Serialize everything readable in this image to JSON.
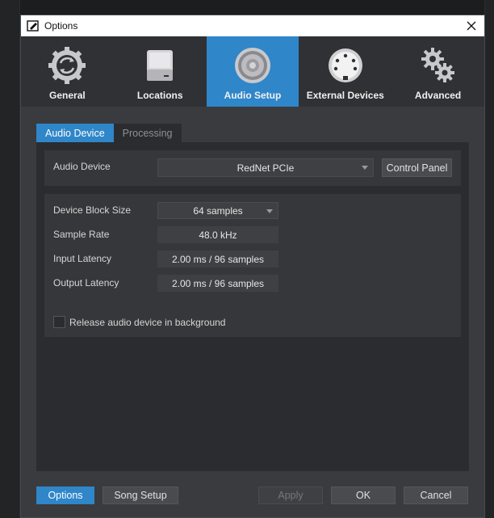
{
  "window": {
    "title": "Options"
  },
  "categories": [
    {
      "label": "General",
      "icon": "refresh-gear-icon",
      "active": false
    },
    {
      "label": "Locations",
      "icon": "hard-drive-icon",
      "active": false
    },
    {
      "label": "Audio Setup",
      "icon": "speaker-icon",
      "active": true
    },
    {
      "label": "External Devices",
      "icon": "midi-connector-icon",
      "active": false
    },
    {
      "label": "Advanced",
      "icon": "gears-icon",
      "active": false
    }
  ],
  "tabs": [
    {
      "label": "Audio Device",
      "active": true
    },
    {
      "label": "Processing",
      "active": false
    }
  ],
  "audio_device": {
    "label": "Audio Device",
    "value": "RedNet PCIe",
    "control_panel_label": "Control Panel"
  },
  "settings": {
    "block_size": {
      "label": "Device Block Size",
      "value": "64 samples"
    },
    "sample_rate": {
      "label": "Sample Rate",
      "value": "48.0 kHz"
    },
    "input_latency": {
      "label": "Input Latency",
      "value": "2.00 ms / 96 samples"
    },
    "output_latency": {
      "label": "Output Latency",
      "value": "2.00 ms / 96 samples"
    }
  },
  "release_background": {
    "label": "Release audio device in background",
    "checked": false
  },
  "footer": {
    "options_label": "Options",
    "song_setup_label": "Song Setup",
    "apply_label": "Apply",
    "ok_label": "OK",
    "cancel_label": "Cancel"
  },
  "colors": {
    "accent": "#2f86c9",
    "window_bg": "#3a3b3e",
    "panel_bg": "#2b2c2f"
  }
}
